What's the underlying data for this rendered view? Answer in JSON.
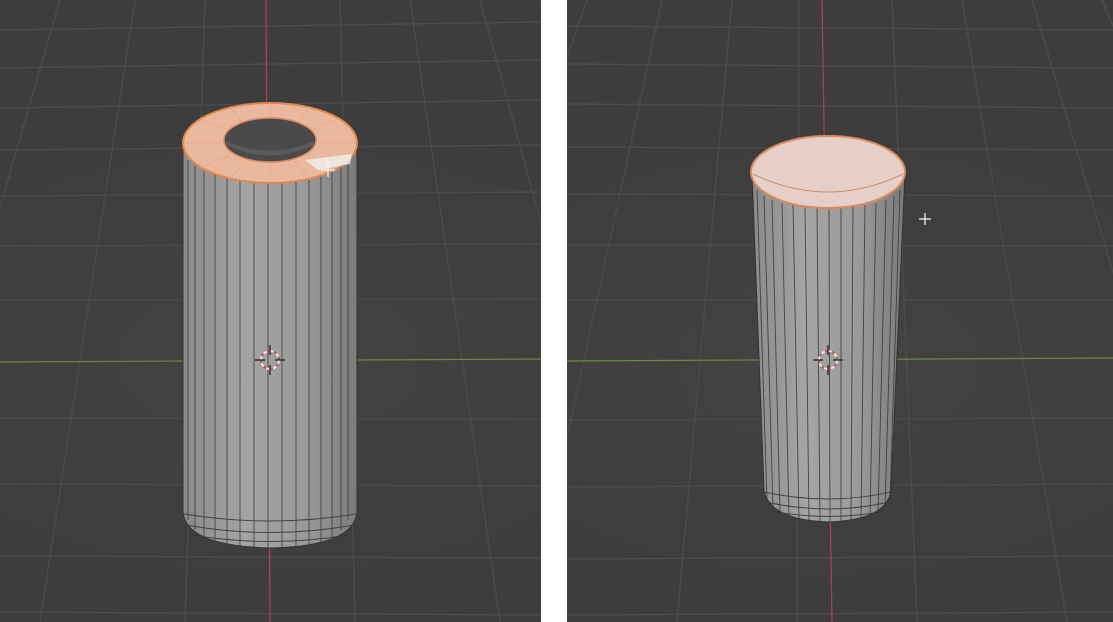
{
  "theme": {
    "viewport_bg": "#3d3d3d",
    "grid_line": "#4a4a4a",
    "x_axis": "#6f8a3a",
    "z_axis": "#b0405a",
    "mesh_face": "#9a9a9a",
    "mesh_edge": "#2e2e2e",
    "selected_face": "#e9b89f",
    "selected_edge": "#e0894f",
    "cap_face": "#e6cfc9"
  },
  "viewports": [
    {
      "name": "viewport-left",
      "object": "cylinder-with-inset-top-face",
      "top_face_selected": true,
      "inner_hole": true
    },
    {
      "name": "viewport-right",
      "object": "cylinder-with-filled-top-face",
      "top_face_selected": true,
      "inner_hole": false
    }
  ],
  "icons": [
    "3d-cursor-icon",
    "mouse-crosshair-icon"
  ]
}
